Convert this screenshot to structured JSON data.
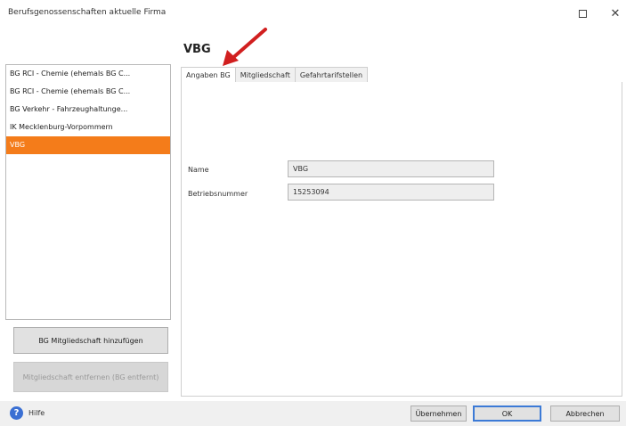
{
  "window": {
    "title": "Berufsgenossenschaften aktuelle Firma",
    "maximize_label": "□",
    "close_label": "✕"
  },
  "list": {
    "items": [
      {
        "label": "BG RCI - Chemie (ehemals BG C...",
        "selected": false
      },
      {
        "label": "BG RCI - Chemie (ehemals BG C...",
        "selected": false
      },
      {
        "label": "BG Verkehr - Fahrzeughaltunge...",
        "selected": false
      },
      {
        "label": "IK Mecklenburg-Vorpommern",
        "selected": false
      },
      {
        "label": "VBG",
        "selected": true
      }
    ]
  },
  "left_buttons": {
    "add_label": "BG Mitgliedschaft hinzufügen",
    "remove_label": "Mitgliedschaft entfernen (BG entfernt)"
  },
  "detail": {
    "heading": "VBG",
    "tabs": [
      "Angaben BG",
      "Mitgliedschaft",
      "Gefahrtarifstellen"
    ],
    "name_label": "Name",
    "name_value": "VBG",
    "betrieb_label": "Betriebsnummer",
    "betrieb_value": "15253094"
  },
  "footer": {
    "help_label": "Hilfe",
    "help_icon": "?",
    "apply_label": "Übernehmen",
    "ok_label": "OK",
    "cancel_label": "Abbrechen"
  },
  "colors": {
    "selection": "#f47c1a",
    "annotation_arrow": "#d11f1f"
  }
}
